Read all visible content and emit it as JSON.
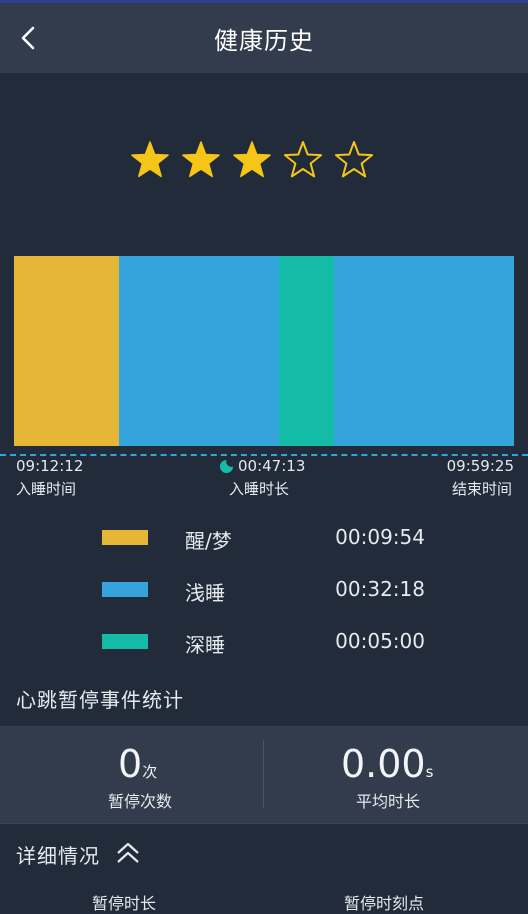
{
  "header": {
    "title": "健康历史",
    "back_icon": "chevron-left-icon"
  },
  "rating": {
    "filled": 3,
    "total": 5,
    "color": "#f5c518"
  },
  "sleep_chart": {
    "type": "bar",
    "segments": [
      {
        "stage": "醒/梦",
        "color": "#e6b637",
        "duration": 0.21
      },
      {
        "stage": "浅睡",
        "color": "#35a4dc",
        "duration": 0.32
      },
      {
        "stage": "深睡",
        "color": "#14bba6",
        "duration": 0.11
      },
      {
        "stage": "浅睡",
        "color": "#35a4dc",
        "duration": 0.36
      }
    ]
  },
  "timeline": {
    "start_time": "09:12:12",
    "start_label": "入睡时间",
    "duration": "00:47:13",
    "duration_label": "入睡时长",
    "end_time": "09:59:25",
    "end_label": "结束时间"
  },
  "legend": [
    {
      "label": "醒/梦",
      "time": "00:09:54",
      "color": "#e6b637"
    },
    {
      "label": "浅睡",
      "time": "00:32:18",
      "color": "#35a4dc"
    },
    {
      "label": "深睡",
      "time": "00:05:00",
      "color": "#14bba6"
    }
  ],
  "apnea": {
    "section_title": "心跳暂停事件统计",
    "count_value": "0",
    "count_unit": "次",
    "count_label": "暂停次数",
    "avg_value": "0.00",
    "avg_unit": "s",
    "avg_label": "平均时长"
  },
  "details": {
    "title": "详细情况",
    "toggle_icon": "double-chevron-up-icon",
    "col1": "暂停时长",
    "col2": "暂停时刻点"
  }
}
